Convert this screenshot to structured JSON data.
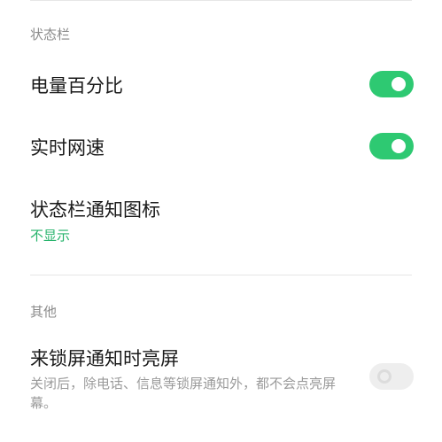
{
  "status_bar_section": {
    "header": "状态栏",
    "items": [
      {
        "title": "电量百分比",
        "toggle": "on"
      },
      {
        "title": "实时网速",
        "toggle": "on"
      },
      {
        "title": "状态栏通知图标",
        "value": "不显示"
      }
    ]
  },
  "other_section": {
    "header": "其他",
    "items": [
      {
        "title": "来锁屏通知时亮屏",
        "description": "关闭后，除电话、信息等锁屏通知外，都不会点亮屏幕。",
        "toggle": "off"
      }
    ]
  },
  "colors": {
    "toggle_on": "#2ec972",
    "value_green": "#26b36b",
    "toggle_off": "#eeeeee"
  }
}
